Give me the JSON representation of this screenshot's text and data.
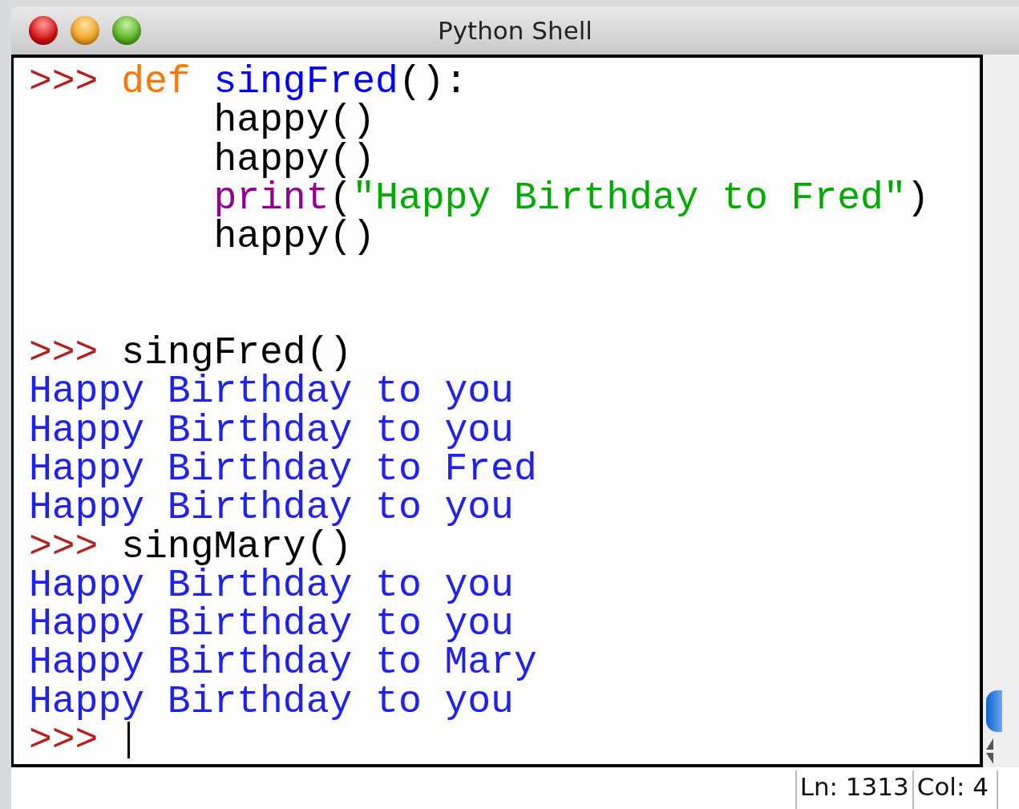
{
  "window": {
    "title": "Python Shell"
  },
  "shell": {
    "lines": [
      {
        "kind": "code",
        "indented": false,
        "tokens": [
          {
            "kind": "prompt",
            "text": ">>> "
          },
          {
            "kind": "keyword",
            "text": "def"
          },
          {
            "kind": "definition",
            "text": "singFred"
          },
          {
            "kind": "plain",
            "text": "():"
          }
        ]
      },
      {
        "kind": "code",
        "indented": true,
        "tokens": [
          {
            "kind": "plain",
            "text": "happy()"
          }
        ]
      },
      {
        "kind": "code",
        "indented": true,
        "tokens": [
          {
            "kind": "plain",
            "text": "happy()"
          }
        ]
      },
      {
        "kind": "code",
        "indented": true,
        "tokens": [
          {
            "kind": "builtin",
            "text": "print"
          },
          {
            "kind": "plain",
            "text": "("
          },
          {
            "kind": "string",
            "text": "\"Happy Birthday to Fred\""
          },
          {
            "kind": "plain",
            "text": ")"
          }
        ]
      },
      {
        "kind": "code",
        "indented": true,
        "tokens": [
          {
            "kind": "plain",
            "text": "happy()"
          }
        ]
      },
      {
        "kind": "blank"
      },
      {
        "kind": "blank"
      },
      {
        "kind": "code",
        "tokens": [
          {
            "kind": "prompt",
            "text": ">>> "
          },
          {
            "kind": "plain",
            "text": "singFred()"
          }
        ]
      },
      {
        "kind": "code",
        "tokens": [
          {
            "kind": "output",
            "text": "Happy Birthday to you"
          }
        ]
      },
      {
        "kind": "code",
        "tokens": [
          {
            "kind": "output",
            "text": "Happy Birthday to you"
          }
        ]
      },
      {
        "kind": "code",
        "tokens": [
          {
            "kind": "output",
            "text": "Happy Birthday to Fred"
          }
        ]
      },
      {
        "kind": "code",
        "tokens": [
          {
            "kind": "output",
            "text": "Happy Birthday to you"
          }
        ]
      },
      {
        "kind": "code",
        "tokens": [
          {
            "kind": "prompt",
            "text": ">>> "
          },
          {
            "kind": "plain",
            "text": "singMary()"
          }
        ]
      },
      {
        "kind": "code",
        "tokens": [
          {
            "kind": "output",
            "text": "Happy Birthday to you"
          }
        ]
      },
      {
        "kind": "code",
        "tokens": [
          {
            "kind": "output",
            "text": "Happy Birthday to you"
          }
        ]
      },
      {
        "kind": "code",
        "tokens": [
          {
            "kind": "output",
            "text": "Happy Birthday to Mary"
          }
        ]
      },
      {
        "kind": "code",
        "tokens": [
          {
            "kind": "output",
            "text": "Happy Birthday to you"
          }
        ]
      },
      {
        "kind": "input",
        "tokens": [
          {
            "kind": "prompt",
            "text": ">>> "
          }
        ]
      }
    ]
  },
  "status_bar": {
    "line": "Ln: 1313",
    "column": "Col: 4"
  }
}
